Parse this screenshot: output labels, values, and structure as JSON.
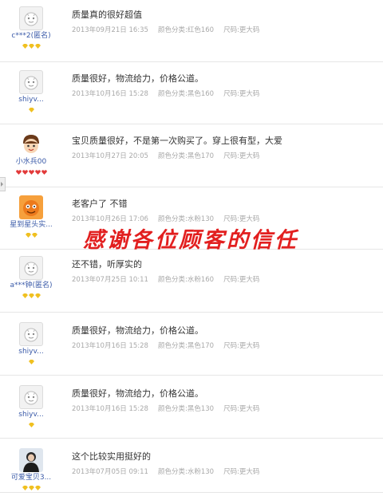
{
  "overlay_text": "感谢各位顾客的信任",
  "colors": {
    "overlay": "#e21f1f",
    "username": "#3a5aa8",
    "meta": "#a9a9a9",
    "gold_badge": "#f0c020",
    "red_badge": "#e23a3a"
  },
  "reviews": [
    {
      "username": "c***2(匿名)",
      "avatar": "default-avatar-icon",
      "badges": "3 gold diamonds",
      "text": "质量真的很好超值",
      "date": "2013年09月21日 16:35",
      "color": "颜色分类:红色160",
      "size": "尺码:更大码"
    },
    {
      "username": "shiyv...",
      "avatar": "default-avatar-icon",
      "badges": "1 gold diamond",
      "text": "质量很好，物流给力，价格公道。",
      "date": "2013年10月16日 15:28",
      "color": "颜色分类:黑色160",
      "size": "尺码:更大码"
    },
    {
      "username": "小水兵00",
      "avatar": "cartoon-avatar-icon",
      "badges": "5 red hearts",
      "text": "宝贝质量很好，不是第一次购买了。穿上很有型，大爱",
      "date": "2013年10月27日 20:05",
      "color": "颜色分类:黑色170",
      "size": "尺码:更大码"
    },
    {
      "username": "星到星头实...",
      "avatar": "orange-avatar-icon",
      "badges": "2 gold diamonds",
      "text": "老客户了 不错",
      "date": "2013年10月26日 17:06",
      "color": "颜色分类:水粉130",
      "size": "尺码:更大码"
    },
    {
      "username": "a***钟(匿名)",
      "avatar": "default-avatar-icon",
      "badges": "3 gold diamonds",
      "text": "还不错，听厚实的",
      "date": "2013年07月25日 10:11",
      "color": "颜色分类:水粉160",
      "size": "尺码:更大码"
    },
    {
      "username": "shiyv...",
      "avatar": "default-avatar-icon",
      "badges": "1 gold diamond",
      "text": "质量很好，物流给力，价格公道。",
      "date": "2013年10月16日 15:28",
      "color": "颜色分类:黑色170",
      "size": "尺码:更大码"
    },
    {
      "username": "shiyv...",
      "avatar": "default-avatar-icon",
      "badges": "1 gold diamond",
      "text": "质量很好，物流给力，价格公道。",
      "date": "2013年10月16日 15:28",
      "color": "颜色分类:黑色130",
      "size": "尺码:更大码"
    },
    {
      "username": "可爱宝贝3...",
      "avatar": "photo-avatar-icon",
      "badges": "3 gold diamonds",
      "text": "这个比较实用挺好的",
      "date": "2013年07月05日 09:11",
      "color": "颜色分类:水粉130",
      "size": "尺码:更大码"
    }
  ]
}
